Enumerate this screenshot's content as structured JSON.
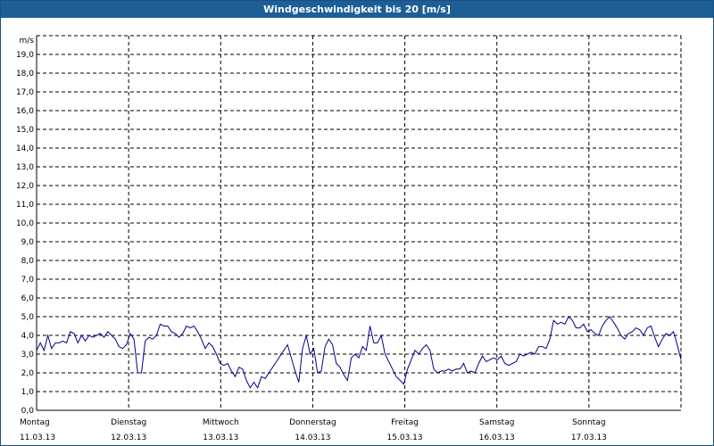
{
  "header": {
    "title": "Windgeschwindigkeit bis 20 [m/s]"
  },
  "chart_data": {
    "type": "line",
    "title": "Windgeschwindigkeit bis 20 [m/s]",
    "ylabel": "m/s",
    "xlabel": "",
    "ylim": [
      0,
      20
    ],
    "xlim": [
      0,
      7
    ],
    "grid": true,
    "line_color": "#00008b",
    "y_ticks": [
      "0,0",
      "1,0",
      "2,0",
      "3,0",
      "4,0",
      "5,0",
      "6,0",
      "7,0",
      "8,0",
      "9,0",
      "10,0",
      "11,0",
      "12,0",
      "13,0",
      "14,0",
      "15,0",
      "16,0",
      "17,0",
      "18,0",
      "19,0"
    ],
    "x_ticks": [
      {
        "day": "Montag",
        "date": "11.03.13"
      },
      {
        "day": "Dienstag",
        "date": "12.03.13"
      },
      {
        "day": "Mittwoch",
        "date": "13.03.13"
      },
      {
        "day": "Donnerstag",
        "date": "14.03.13"
      },
      {
        "day": "Freitag",
        "date": "15.03.13"
      },
      {
        "day": "Samstag",
        "date": "16.03.13"
      },
      {
        "day": "Sonntag",
        "date": "17.03.13"
      }
    ],
    "series": [
      {
        "values": [
          3.2,
          3.6,
          3.2,
          4.0,
          3.3,
          3.6,
          3.6,
          3.7,
          3.6,
          4.2,
          4.1,
          3.6,
          4.0,
          3.7,
          4.0,
          3.9,
          4.0,
          4.1,
          3.9,
          4.2,
          4.0,
          3.8,
          3.4,
          3.3,
          3.5,
          4.1,
          3.8,
          2.0,
          2.0,
          3.7,
          3.9,
          3.8,
          4.0,
          4.6,
          4.5,
          4.5,
          4.2,
          4.1,
          3.9,
          4.1,
          4.5,
          4.4,
          4.5,
          4.2,
          3.8,
          3.3,
          3.6,
          3.4,
          3.0,
          2.5,
          2.4,
          2.5,
          2.1,
          1.8,
          2.3,
          2.2,
          1.6,
          1.2,
          1.5,
          1.2,
          1.8,
          1.7,
          2.0,
          2.3,
          2.6,
          2.9,
          3.2,
          3.5,
          2.8,
          2.1,
          1.5,
          3.3,
          4.0,
          3.0,
          3.3,
          2.0,
          2.1,
          3.4,
          3.8,
          3.5,
          2.5,
          2.3,
          1.9,
          1.6,
          2.8,
          3.0,
          2.8,
          3.4,
          3.2,
          4.5,
          3.6,
          3.6,
          4.0,
          3.0,
          2.6,
          2.2,
          1.8,
          1.6,
          1.4,
          2.2,
          2.7,
          3.2,
          3.0,
          3.3,
          3.5,
          3.2,
          2.2,
          2.0,
          2.1,
          2.1,
          2.2,
          2.1,
          2.2,
          2.2,
          2.5,
          2.0,
          2.1,
          2.0,
          2.5,
          2.9,
          2.6,
          2.7,
          2.8,
          2.7,
          2.9,
          2.5,
          2.4,
          2.5,
          2.6,
          3.0,
          2.9,
          3.0,
          3.1,
          3.0,
          3.4,
          3.4,
          3.3,
          3.8,
          4.8,
          4.6,
          4.7,
          4.6,
          5.0,
          4.8,
          4.4,
          4.4,
          4.6,
          4.2,
          4.3,
          4.1,
          4.0,
          4.5,
          4.8,
          5.0,
          4.7,
          4.4,
          4.0,
          3.8,
          4.1,
          4.2,
          4.4,
          4.3,
          4.0,
          4.4,
          4.5,
          3.9,
          3.4,
          3.8,
          4.1,
          4.0,
          4.2,
          3.5,
          2.7
        ]
      }
    ]
  }
}
